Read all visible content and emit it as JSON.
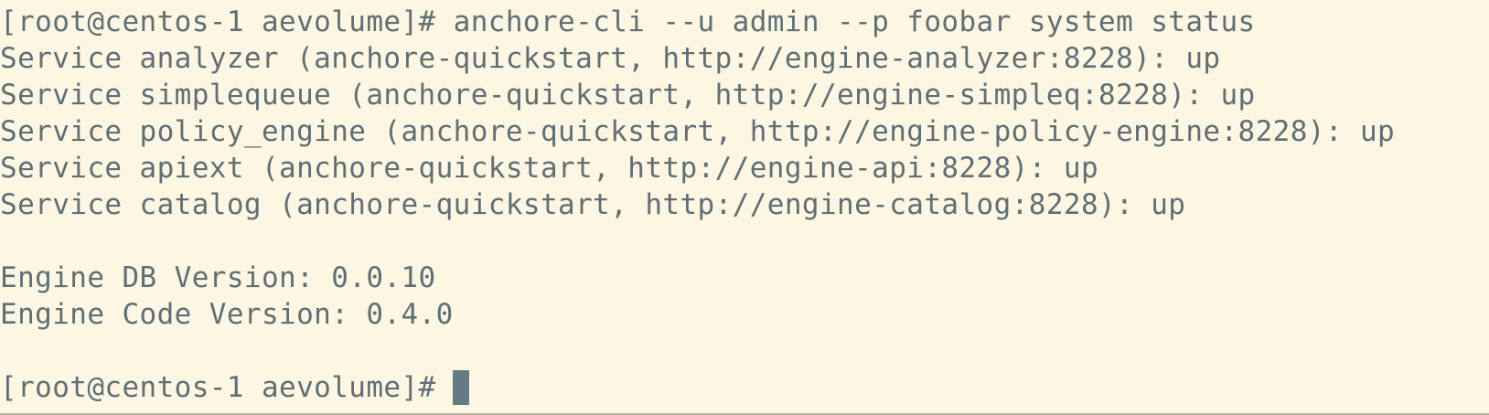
{
  "terminal": {
    "command_line": "[root@centos-1 aevolume]# anchore-cli --u admin --p foobar system status",
    "services": [
      "Service analyzer (anchore-quickstart, http://engine-analyzer:8228): up",
      "Service simplequeue (anchore-quickstart, http://engine-simpleq:8228): up",
      "Service policy_engine (anchore-quickstart, http://engine-policy-engine:8228): up",
      "Service apiext (anchore-quickstart, http://engine-api:8228): up",
      "Service catalog (anchore-quickstart, http://engine-catalog:8228): up"
    ],
    "db_version": "Engine DB Version: 0.0.10",
    "code_version": "Engine Code Version: 0.4.0",
    "prompt": "[root@centos-1 aevolume]#"
  },
  "colors": {
    "background": "#fdf6e3",
    "text": "#5f6f74",
    "cursor": "#657b83"
  }
}
